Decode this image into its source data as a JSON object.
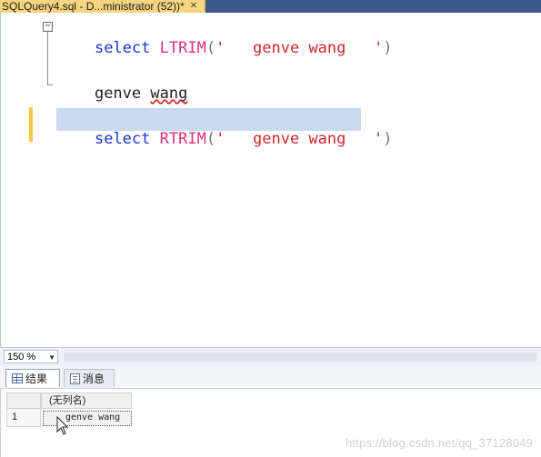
{
  "tab": {
    "title": "SQLQuery4.sql - D...ministrator (52))*",
    "close_glyph": "✕"
  },
  "editor": {
    "fold_glyph": "−",
    "line1": {
      "keyword": "select",
      "func": "LTRIM",
      "open": "(",
      "literal": "'   genve wang   '",
      "close": ")"
    },
    "line2": {
      "text1": "genve ",
      "text2": "wang"
    },
    "line3": {
      "keyword": "select",
      "func": "RTRIM",
      "open": "(",
      "literal": "'   genve wang   '",
      "close": ")"
    }
  },
  "zoom": {
    "value": "150 %"
  },
  "results_tabs": [
    {
      "label": "结果",
      "icon": "grid-icon",
      "active": true
    },
    {
      "label": "消息",
      "icon": "message-icon",
      "active": false
    }
  ],
  "results_grid": {
    "column_header": "(无列名)",
    "rows": [
      {
        "index": "1",
        "value": "genve wang"
      }
    ]
  },
  "watermark": "https://blog.csdn.net/qq_37128049",
  "colors": {
    "tab_active": "#f6d581",
    "keyword": "#1a33d6",
    "function": "#e0307a",
    "string": "#d0282d",
    "selection": "#c7daf0"
  }
}
